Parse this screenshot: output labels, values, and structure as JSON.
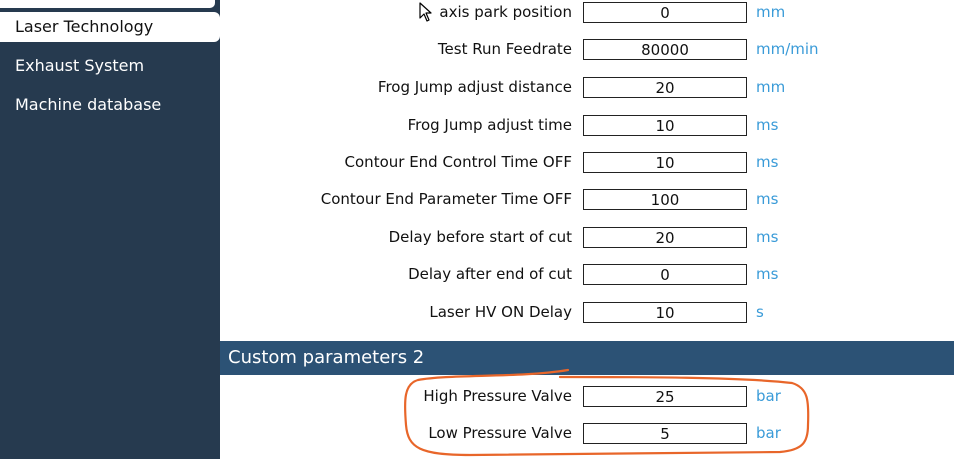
{
  "sidebar": {
    "items": [
      {
        "label": "Laser Technology",
        "active": true
      },
      {
        "label": "Exhaust System",
        "active": false
      },
      {
        "label": "Machine database",
        "active": false
      }
    ]
  },
  "parameters": [
    {
      "label": "axis park position",
      "value": "0",
      "unit": "mm"
    },
    {
      "label": "Test Run Feedrate",
      "value": "80000",
      "unit": "mm/min"
    },
    {
      "label": "Frog Jump adjust distance",
      "value": "20",
      "unit": "mm"
    },
    {
      "label": "Frog Jump adjust time",
      "value": "10",
      "unit": "ms"
    },
    {
      "label": "Contour End Control Time OFF",
      "value": "10",
      "unit": "ms"
    },
    {
      "label": "Contour End Parameter Time OFF",
      "value": "100",
      "unit": "ms"
    },
    {
      "label": "Delay before start of cut",
      "value": "20",
      "unit": "ms"
    },
    {
      "label": "Delay after end of cut",
      "value": "0",
      "unit": "ms"
    },
    {
      "label": "Laser HV ON Delay",
      "value": "10",
      "unit": "s"
    }
  ],
  "custom_section": {
    "title": "Custom parameters 2",
    "parameters": [
      {
        "label": "High Pressure Valve",
        "value": "25",
        "unit": "bar"
      },
      {
        "label": "Low Pressure Valve",
        "value": "5",
        "unit": "bar"
      }
    ]
  },
  "colors": {
    "sidebar_bg": "#263a4f",
    "section_header_bg": "#2c5275",
    "unit_text": "#3a9bd8",
    "annotation_stroke": "#e8662a"
  },
  "icons": {
    "cursor": "arrow-pointer-icon"
  }
}
